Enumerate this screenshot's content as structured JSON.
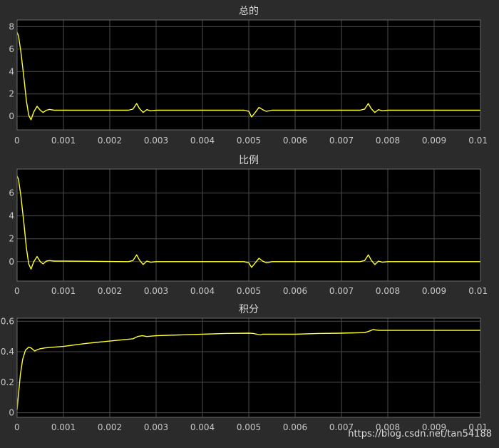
{
  "colors": {
    "figure_bg": "#2b2b2b",
    "plot_bg": "#000000",
    "grid": "#4d4d4d",
    "axis_text": "#c8c8c8",
    "signal": "#ffff2e"
  },
  "watermark": "https://blog.csdn.net/tan54188",
  "chart_data": [
    {
      "type": "line",
      "title": "总的",
      "xlim": [
        0,
        0.01
      ],
      "ylim": [
        -1.2,
        8.6
      ],
      "x_ticks": [
        0,
        0.001,
        0.002,
        0.003,
        0.004,
        0.005,
        0.006,
        0.007,
        0.008,
        0.009,
        0.01
      ],
      "x_tick_labels": [
        "0",
        "0.001",
        "0.002",
        "0.003",
        "0.004",
        "0.005",
        "0.006",
        "0.007",
        "0.008",
        "0.009",
        "0.01"
      ],
      "y_ticks": [
        0,
        2,
        4,
        6,
        8
      ],
      "y_tick_labels": [
        "0",
        "2",
        "4",
        "6",
        "8"
      ],
      "grid": true,
      "series": [
        {
          "x": [
            0,
            3e-05,
            8e-05,
            0.00015,
            0.0002,
            0.00025,
            0.0003,
            0.00036,
            0.00043,
            0.0005,
            0.00056,
            0.00063,
            0.0007,
            0.0008,
            0.001,
            0.0024,
            0.0025,
            0.00258,
            0.00264,
            0.00272,
            0.0028,
            0.00288,
            0.003,
            0.0049,
            0.005,
            0.00506,
            0.00514,
            0.00522,
            0.0053,
            0.00538,
            0.0055,
            0.0074,
            0.0075,
            0.00758,
            0.00764,
            0.00772,
            0.0078,
            0.00788,
            0.008,
            0.01
          ],
          "y": [
            7.5,
            7.2,
            5.8,
            3.3,
            1.4,
            0.1,
            -0.3,
            0.4,
            0.9,
            0.55,
            0.35,
            0.55,
            0.62,
            0.55,
            0.55,
            0.55,
            0.65,
            1.15,
            0.7,
            0.35,
            0.6,
            0.5,
            0.55,
            0.55,
            0.45,
            -0.05,
            0.35,
            0.8,
            0.6,
            0.45,
            0.55,
            0.55,
            0.65,
            1.15,
            0.7,
            0.35,
            0.6,
            0.5,
            0.55,
            0.55
          ]
        }
      ]
    },
    {
      "type": "line",
      "title": "比例",
      "xlim": [
        0,
        0.01
      ],
      "ylim": [
        -1.7,
        8.1
      ],
      "x_ticks": [
        0,
        0.001,
        0.002,
        0.003,
        0.004,
        0.005,
        0.006,
        0.007,
        0.008,
        0.009,
        0.01
      ],
      "x_tick_labels": [
        "0",
        "0.001",
        "0.002",
        "0.003",
        "0.004",
        "0.005",
        "0.006",
        "0.007",
        "0.008",
        "0.009",
        "0.01"
      ],
      "y_ticks": [
        0,
        2,
        4,
        6
      ],
      "y_tick_labels": [
        "0",
        "2",
        "4",
        "6"
      ],
      "grid": true,
      "series": [
        {
          "x": [
            0,
            3e-05,
            8e-05,
            0.00015,
            0.0002,
            0.00025,
            0.0003,
            0.00036,
            0.00043,
            0.0005,
            0.00056,
            0.00063,
            0.0007,
            0.0008,
            0.001,
            0.0024,
            0.0025,
            0.00258,
            0.00264,
            0.00272,
            0.0028,
            0.00288,
            0.003,
            0.0049,
            0.005,
            0.00506,
            0.00514,
            0.00522,
            0.0053,
            0.00538,
            0.0055,
            0.0074,
            0.0075,
            0.00758,
            0.00764,
            0.00772,
            0.0078,
            0.00788,
            0.008,
            0.01
          ],
          "y": [
            7.5,
            7.2,
            5.8,
            3.2,
            1.2,
            -0.2,
            -0.65,
            0.0,
            0.45,
            0.0,
            -0.2,
            0.05,
            0.1,
            0.05,
            0.05,
            0.0,
            0.1,
            0.6,
            0.15,
            -0.25,
            0.05,
            -0.05,
            0.0,
            0.0,
            -0.1,
            -0.5,
            -0.1,
            0.3,
            0.05,
            -0.1,
            0.0,
            0.0,
            0.1,
            0.6,
            0.15,
            -0.25,
            0.05,
            -0.05,
            0.0,
            0.0
          ]
        }
      ]
    },
    {
      "type": "line",
      "title": "积分",
      "xlim": [
        0,
        0.01
      ],
      "ylim": [
        -0.03,
        0.62
      ],
      "x_ticks": [
        0,
        0.001,
        0.002,
        0.003,
        0.004,
        0.005,
        0.006,
        0.007,
        0.008,
        0.009,
        0.01
      ],
      "x_tick_labels": [
        "0",
        "0.001",
        "0.002",
        "0.003",
        "0.004",
        "0.005",
        "0.006",
        "0.007",
        "0.008",
        "0.009",
        "0.01"
      ],
      "y_ticks": [
        0,
        0.2,
        0.4,
        0.6
      ],
      "y_tick_labels": [
        "0",
        "0.2",
        "0.4",
        "0.6"
      ],
      "grid": true,
      "series": [
        {
          "x": [
            0,
            3e-05,
            7e-05,
            0.00012,
            0.00018,
            0.00025,
            0.0003,
            0.00038,
            0.00045,
            0.0005,
            0.0006,
            0.0008,
            0.001,
            0.0015,
            0.002,
            0.0025,
            0.0026,
            0.0027,
            0.0028,
            0.003,
            0.0035,
            0.004,
            0.0045,
            0.005,
            0.0051,
            0.00525,
            0.0053,
            0.006,
            0.0065,
            0.007,
            0.0075,
            0.0076,
            0.00768,
            0.0078,
            0.008,
            0.009,
            0.01
          ],
          "y": [
            0.02,
            0.12,
            0.25,
            0.35,
            0.41,
            0.43,
            0.425,
            0.405,
            0.415,
            0.42,
            0.425,
            0.43,
            0.435,
            0.455,
            0.47,
            0.485,
            0.5,
            0.505,
            0.5,
            0.505,
            0.51,
            0.515,
            0.52,
            0.522,
            0.52,
            0.51,
            0.515,
            0.515,
            0.52,
            0.522,
            0.525,
            0.535,
            0.545,
            0.54,
            0.54,
            0.54,
            0.54
          ]
        }
      ]
    }
  ]
}
